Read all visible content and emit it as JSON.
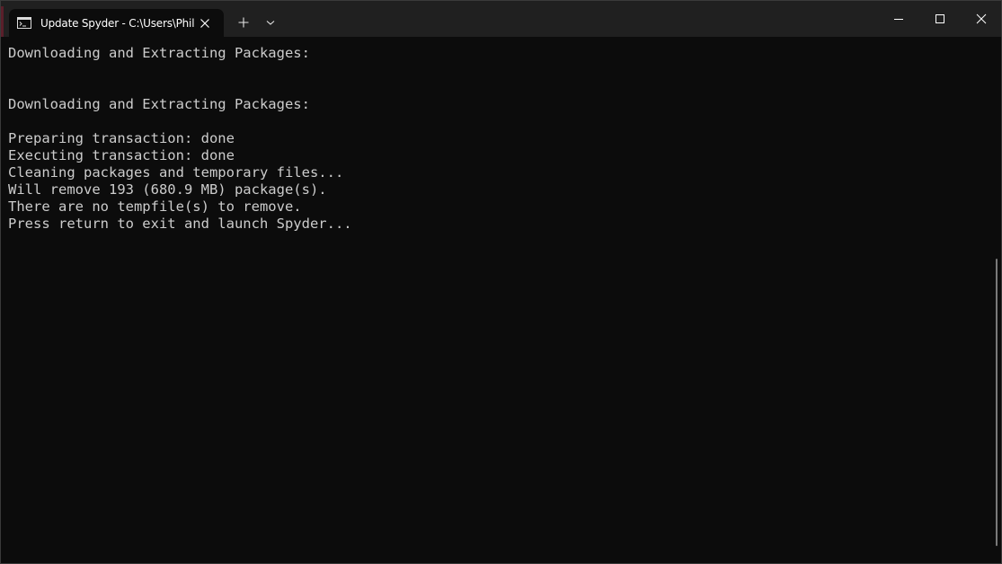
{
  "tab": {
    "title": "Update Spyder - C:\\Users\\Phil",
    "icon": "terminal-icon"
  },
  "titlebar": {
    "new_tab_icon": "plus-icon",
    "dropdown_icon": "chevron-down-icon",
    "minimize_icon": "minimize-icon",
    "maximize_icon": "maximize-icon",
    "close_icon": "close-icon"
  },
  "terminal": {
    "lines": [
      "Downloading and Extracting Packages:",
      "",
      "",
      "Downloading and Extracting Packages:",
      "",
      "Preparing transaction: done",
      "Executing transaction: done",
      "Cleaning packages and temporary files...",
      "Will remove 193 (680.9 MB) package(s).",
      "There are no tempfile(s) to remove.",
      "Press return to exit and launch Spyder..."
    ]
  },
  "colors": {
    "terminal_background": "#0c0c0c",
    "titlebar_background": "#202020",
    "text": "#cccccc"
  }
}
